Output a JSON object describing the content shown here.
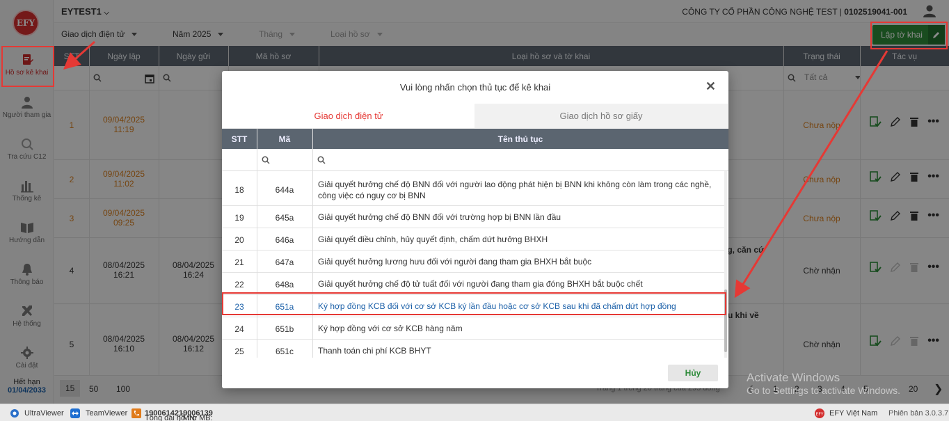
{
  "sidebar": {
    "logo": "EFY",
    "items": [
      {
        "label": "Hồ sơ kê khai",
        "icon": "document-edit-icon"
      },
      {
        "label": "Người tham gia",
        "icon": "person-icon"
      },
      {
        "label": "Tra cứu C12",
        "icon": "search-icon"
      },
      {
        "label": "Thống kê",
        "icon": "bar-chart-icon"
      },
      {
        "label": "Hướng dẫn",
        "icon": "book-icon"
      },
      {
        "label": "Thông báo",
        "icon": "bell-icon"
      },
      {
        "label": "Hệ thống",
        "icon": "tools-icon"
      },
      {
        "label": "Cài đặt",
        "icon": "gear-icon"
      }
    ],
    "expiry_label": "Hết hạn",
    "expiry_date": "01/04/2033"
  },
  "header": {
    "tenant": "EYTEST1",
    "company": "CÔNG TY CỔ PHẦN CÔNG NGHỆ TEST | ",
    "tax_code": "0102519041-001"
  },
  "filters": {
    "transaction_type": "Giao dịch điện tử",
    "year": "Năm 2025",
    "month": "Tháng",
    "record_type": "Loại hồ sơ",
    "create_button": "Lập tờ khai"
  },
  "table": {
    "columns": [
      "STT",
      "Ngày lập",
      "Ngày gửi",
      "Mã hồ sơ",
      "Loại hồ sơ và tờ khai",
      "Trạng thái",
      "Tác vụ"
    ],
    "status_filter": "Tất cả",
    "rows": [
      {
        "stt": "1",
        "created_date": "09/04/2025",
        "created_time": "11:19",
        "sent_date": "",
        "sent_time": "",
        "status": "Chưa nộp",
        "extra": ""
      },
      {
        "stt": "2",
        "created_date": "09/04/2025",
        "created_time": "11:02",
        "sent_date": "",
        "sent_time": "",
        "status": "Chưa nộp",
        "extra": ""
      },
      {
        "stt": "3",
        "created_date": "09/04/2025",
        "created_time": "09:25",
        "sent_date": "",
        "sent_time": "",
        "status": "Chưa nộp",
        "extra": ""
      },
      {
        "stt": "4",
        "created_date": "08/04/2025",
        "created_time": "16:21",
        "sent_date": "08/04/2025",
        "sent_time": "16:24",
        "status": "Chờ nhận",
        "extra": "ng, căn cứ"
      },
      {
        "stt": "5",
        "created_date": "08/04/2025",
        "created_time": "16:10",
        "sent_date": "08/04/2025",
        "sent_time": "16:12",
        "status": "Chờ nhận",
        "extra": "u khi về"
      }
    ]
  },
  "pager": {
    "sizes": [
      "15",
      "50",
      "100"
    ],
    "summary": "Trang 1 trong 20 trang của 295 dòng",
    "pages": [
      "1",
      "2",
      "3",
      "4",
      "5",
      "20"
    ]
  },
  "modal": {
    "title": "Vui lòng nhấn chọn thủ tục để kê khai",
    "tab_active": "Giao dịch điện tử",
    "tab_idle": "Giao dịch hồ sơ giấy",
    "columns": [
      "STT",
      "Mã",
      "Tên thủ tục"
    ],
    "rows": [
      {
        "stt": "18",
        "code": "644a",
        "name": "Giải quyết hưởng chế độ BNN đối với người lao động phát hiện bị BNN khi không còn làm trong các nghề, công việc có nguy cơ bị BNN"
      },
      {
        "stt": "19",
        "code": "645a",
        "name": "Giải quyết hưởng chế độ BNN đối với trường hợp bị BNN lần đầu"
      },
      {
        "stt": "20",
        "code": "646a",
        "name": "Giải quyết điều chỉnh, hủy quyết định, chấm dứt hưởng BHXH"
      },
      {
        "stt": "21",
        "code": "647a",
        "name": "Giải quyết hưởng lương hưu đối với người đang tham gia BHXH bắt buộc"
      },
      {
        "stt": "22",
        "code": "648a",
        "name": "Giải quyết hưởng chế độ tử tuất đối với người đang tham gia đóng BHXH bắt buộc chết"
      },
      {
        "stt": "23",
        "code": "651a",
        "name": "Ký hợp đồng KCB đối với cơ sở KCB ký lần đầu hoặc cơ sở KCB sau khi đã chấm dứt hợp đồng"
      },
      {
        "stt": "24",
        "code": "651b",
        "name": "Ký hợp đồng với cơ sở KCB hàng năm"
      },
      {
        "stt": "25",
        "code": "651c",
        "name": "Thanh toán chi phí KCB BHYT"
      }
    ],
    "cancel_button": "Hủy"
  },
  "footer": {
    "ultraviewer": "UltraViewer",
    "teamviewer": "TeamViewer",
    "hotline_label": "Tổng đài hỗ trợ MB: ",
    "hotline_mb": "19006142",
    "hotline_sep": " | MN: ",
    "hotline_mn": "19006139",
    "brand": "EFY Việt Nam",
    "version": "Phiên bản 3.0.3.7"
  },
  "watermark": {
    "line1": "Activate Windows",
    "line2": "Go to Settings to activate Windows."
  },
  "colors": {
    "accent_red": "#e53935",
    "primary_green": "#2e8b3a",
    "header_gray": "#5b6570",
    "pending_orange": "#d67c1c",
    "link_blue": "#1a5fa8"
  }
}
